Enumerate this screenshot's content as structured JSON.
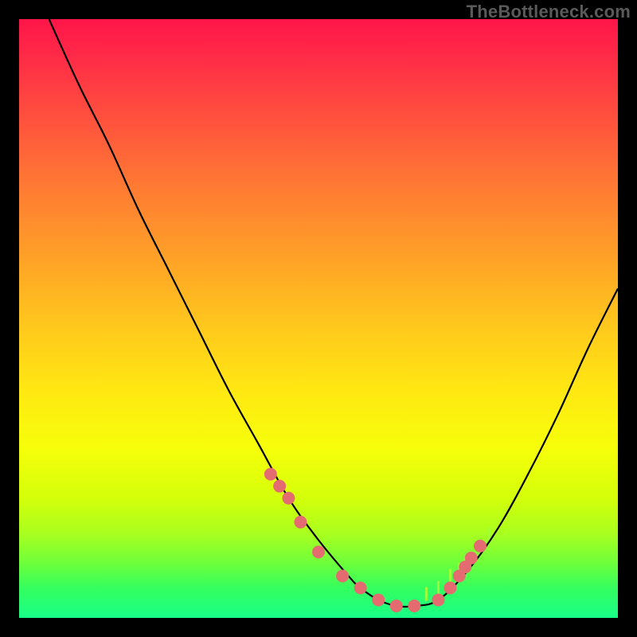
{
  "watermark": "TheBottleneck.com",
  "chart_data": {
    "type": "line",
    "title": "",
    "xlabel": "",
    "ylabel": "",
    "xlim": [
      0,
      100
    ],
    "ylim": [
      0,
      100
    ],
    "grid": false,
    "legend": false,
    "series": [
      {
        "name": "bottleneck-curve",
        "x": [
          5,
          10,
          15,
          20,
          25,
          30,
          35,
          40,
          45,
          50,
          55,
          57,
          60,
          63,
          66,
          70,
          75,
          80,
          85,
          90,
          95,
          100
        ],
        "values": [
          100,
          89,
          79,
          68,
          58,
          48,
          38,
          29,
          20,
          13,
          7,
          5,
          3,
          2,
          2,
          3,
          8,
          15,
          24,
          34,
          45,
          55
        ],
        "color": "#000000"
      }
    ],
    "points": {
      "name": "highlight-dots",
      "color": "#e46b6f",
      "radius": 8,
      "x": [
        42,
        43.5,
        45,
        47,
        50,
        54,
        57,
        60,
        63,
        66,
        70,
        72,
        73.5,
        74.5,
        75.5,
        77
      ],
      "values": [
        24,
        22,
        20,
        16,
        11,
        7,
        5,
        3,
        2,
        2,
        3,
        5,
        7,
        8.5,
        10,
        12
      ]
    },
    "ticks": {
      "name": "grass-ticks",
      "color": "#9fff3a",
      "x": [
        68,
        70,
        72,
        73.5,
        74.5,
        75.5,
        77,
        78.5
      ],
      "values": [
        3,
        4,
        6,
        7,
        8,
        9,
        11,
        13
      ],
      "height_frac": 0.02
    }
  }
}
